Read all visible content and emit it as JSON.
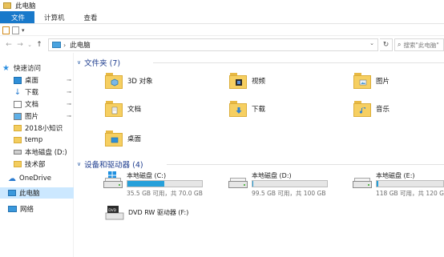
{
  "window": {
    "title": "此电脑",
    "icon": "folder-icon"
  },
  "ribbon": {
    "tabs": [
      "文件",
      "计算机",
      "查看"
    ]
  },
  "quick_access_toolbar": {
    "items": [
      "properties-icon",
      "new-folder-icon",
      "customize-dropdown-icon"
    ]
  },
  "nav": {
    "back_icon": "←",
    "forward_icon": "→",
    "recent_icon": "⌄",
    "up_icon": "↑",
    "address": {
      "crumb": "此电脑",
      "dropdown_icon": "⌄"
    },
    "refresh_icon": "↻",
    "search": {
      "placeholder": "搜索\"此电脑\"",
      "icon": "search-icon"
    }
  },
  "sidebar": {
    "items": [
      {
        "label": "快速访问",
        "icon": "star-icon",
        "pinned": false
      },
      {
        "label": "桌面",
        "icon": "desktop-icon",
        "pinned": true
      },
      {
        "label": "下载",
        "icon": "download-icon",
        "pinned": true
      },
      {
        "label": "文档",
        "icon": "document-icon",
        "pinned": true
      },
      {
        "label": "图片",
        "icon": "pictures-icon",
        "pinned": true
      },
      {
        "label": "2018小知识",
        "icon": "folder-icon",
        "pinned": false
      },
      {
        "label": "temp",
        "icon": "folder-icon",
        "pinned": false
      },
      {
        "label": "本地磁盘 (D:)",
        "icon": "drive-icon",
        "pinned": false
      },
      {
        "label": "技术部",
        "icon": "folder-icon",
        "pinned": false
      },
      {
        "label": "OneDrive",
        "icon": "cloud-icon",
        "pinned": false
      },
      {
        "label": "此电脑",
        "icon": "computer-icon",
        "pinned": false,
        "selected": true
      },
      {
        "label": "网络",
        "icon": "network-icon",
        "pinned": false
      }
    ]
  },
  "folders_group": {
    "title": "文件夹 (7)",
    "items": [
      {
        "label": "3D 对象",
        "icon": "3d-objects-folder-icon"
      },
      {
        "label": "视频",
        "icon": "videos-folder-icon"
      },
      {
        "label": "图片",
        "icon": "pictures-folder-icon"
      },
      {
        "label": "文档",
        "icon": "documents-folder-icon"
      },
      {
        "label": "下载",
        "icon": "downloads-folder-icon"
      },
      {
        "label": "音乐",
        "icon": "music-folder-icon"
      },
      {
        "label": "桌面",
        "icon": "desktop-folder-icon"
      }
    ]
  },
  "devices_group": {
    "title": "设备和驱动器 (4)",
    "drives": [
      {
        "name": "本地磁盘 (C:)",
        "size_text": "35.5 GB 可用，共 70.0 GB",
        "used_fraction": 0.49,
        "icon": "windows-drive-icon"
      },
      {
        "name": "本地磁盘 (D:)",
        "size_text": "99.5 GB 可用，共 100 GB",
        "used_fraction": 0.005,
        "icon": "drive-icon"
      },
      {
        "name": "本地磁盘 (E:)",
        "size_text": "118 GB 可用，共 120 GB",
        "used_fraction": 0.02,
        "icon": "drive-icon"
      },
      {
        "name": "DVD RW 驱动器 (F:)",
        "size_text": "",
        "icon": "dvd-drive-icon"
      }
    ]
  },
  "colors": {
    "accent": "#1979ca",
    "selection": "#cce8ff",
    "group_title": "#1e3d8f",
    "progress": "#26a0da",
    "folder": "#f6cf61"
  }
}
